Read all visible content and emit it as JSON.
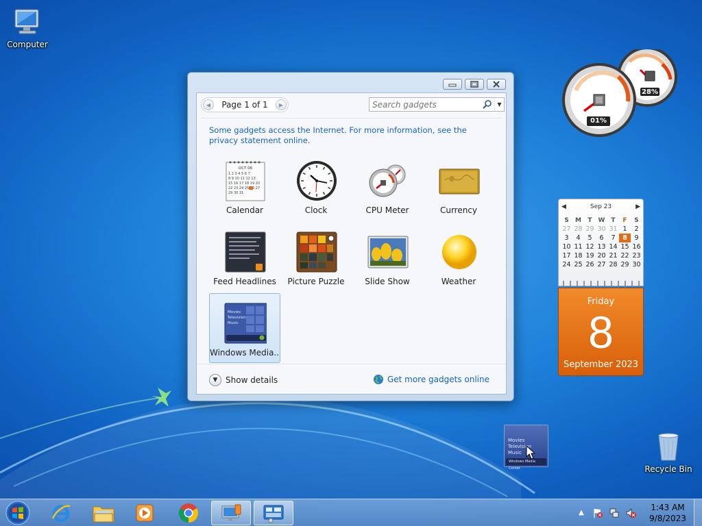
{
  "desktop": {
    "computer_label": "Computer",
    "recycle_label": "Recycle Bin"
  },
  "gadget_window": {
    "pager_label": "Page 1 of 1",
    "search_placeholder": "Search gadgets",
    "info_text": "Some gadgets access the Internet.  For more information, see the privacy statement online.",
    "gadgets": [
      {
        "label": "Calendar",
        "icon": "calendar-icon"
      },
      {
        "label": "Clock",
        "icon": "clock-icon"
      },
      {
        "label": "CPU Meter",
        "icon": "cpu-meter-icon"
      },
      {
        "label": "Currency",
        "icon": "currency-icon"
      },
      {
        "label": "Feed Headlines",
        "icon": "feed-headlines-icon"
      },
      {
        "label": "Picture Puzzle",
        "icon": "picture-puzzle-icon"
      },
      {
        "label": "Slide Show",
        "icon": "slide-show-icon"
      },
      {
        "label": "Weather",
        "icon": "weather-icon"
      },
      {
        "label": "Windows Media...",
        "icon": "windows-media-center-icon",
        "selected": true
      }
    ],
    "calendar_thumb_month": "OCT 06",
    "show_details_label": "Show details",
    "get_more_label": "Get more gadgets online"
  },
  "cpu_gadget": {
    "cpu_value": "01%",
    "memory_value": "28%"
  },
  "calendar_gadget": {
    "month_label": "Sep 23",
    "weekday_headers": [
      "S",
      "M",
      "T",
      "W",
      "T",
      "F",
      "S"
    ],
    "weeks": [
      [
        "27",
        "28",
        "29",
        "30",
        "31",
        "1",
        "2"
      ],
      [
        "3",
        "4",
        "5",
        "6",
        "7",
        "8",
        "9"
      ],
      [
        "10",
        "11",
        "12",
        "13",
        "14",
        "15",
        "16"
      ],
      [
        "17",
        "18",
        "19",
        "20",
        "21",
        "22",
        "23"
      ],
      [
        "24",
        "25",
        "26",
        "27",
        "28",
        "29",
        "30"
      ]
    ],
    "day_name": "Friday",
    "day_number": "8",
    "month_year": "September 2023"
  },
  "wmc_drag": {
    "lines": [
      "Movies",
      "Television",
      "Music"
    ],
    "bar_label": "Windows Media Center"
  },
  "taskbar": {
    "time": "1:43 AM",
    "date": "9/8/2023",
    "pinned": [
      "start-button",
      "internet-explorer",
      "windows-explorer",
      "media-player",
      "chrome",
      "gadgets-control-panel",
      "gadget-gallery"
    ]
  },
  "colors": {
    "accent": "#1464c8",
    "calendar_orange": "#e46a18"
  }
}
